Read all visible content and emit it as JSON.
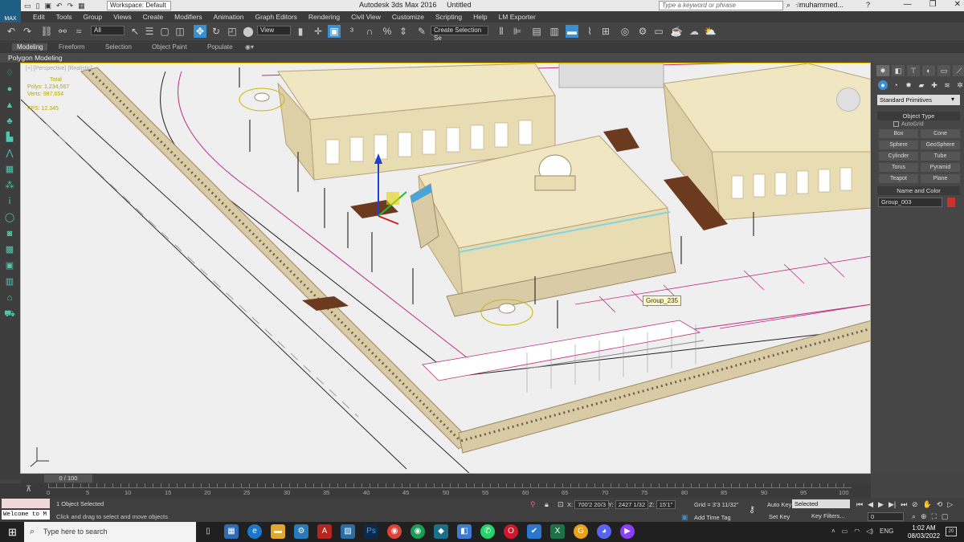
{
  "titlebar": {
    "logo": "MAX",
    "workspace": "Workspace: Default",
    "app_title": "Autodesk 3ds Max 2016",
    "doc_title": "Untitled",
    "search_placeholder": "Type a keyword or phrase",
    "user": "muhammed..."
  },
  "menu": [
    "Edit",
    "Tools",
    "Group",
    "Views",
    "Create",
    "Modifiers",
    "Animation",
    "Graph Editors",
    "Rendering",
    "Civil View",
    "Customize",
    "Scripting",
    "Help",
    "LM Exporter"
  ],
  "toolbar": {
    "filter_value": "All",
    "view_value": "View",
    "selection_set": "Create Selection Se"
  },
  "ribbon": {
    "tabs": [
      "Modeling",
      "Freeform",
      "Selection",
      "Object Paint",
      "Populate"
    ],
    "active": "Modeling",
    "panel_label": "Polygon Modeling"
  },
  "viewport": {
    "label": "[+] [Perspective] [Realistic]",
    "stats": {
      "total": "Total",
      "polys_label": "Polys:",
      "polys": "1,234,567",
      "verts_label": "Verts:",
      "verts": "987,654",
      "fps_label": "FPS:",
      "fps": "12.345"
    },
    "tooltip": "Group_235",
    "colors": {
      "ground": "#efefef",
      "building": "#ece3bf",
      "roof": "#f0e6c2",
      "trim": "#b7a27a",
      "road_line": "#c12b83",
      "boundary": "#e6c300",
      "brick": "#6b3a1f"
    }
  },
  "command_panel": {
    "dropdown": "Standard Primitives",
    "object_type_header": "Object Type",
    "autogrid": "AutoGrid",
    "primitives": [
      "Box",
      "Cone",
      "Sphere",
      "GeoSphere",
      "Cylinder",
      "Tube",
      "Torus",
      "Pyramid",
      "Teapot",
      "Plane"
    ],
    "name_color_header": "Name and Color",
    "object_name": "Group_003",
    "object_color": "#c8322a"
  },
  "timeline": {
    "slider": "0 / 100",
    "ticks": [
      "0",
      "5",
      "10",
      "15",
      "20",
      "25",
      "30",
      "35",
      "40",
      "45",
      "50",
      "55",
      "60",
      "65",
      "70",
      "75",
      "80",
      "85",
      "90",
      "95",
      "100"
    ]
  },
  "status": {
    "listener_text": "Welcome to M",
    "selection": "1 Object Selected",
    "prompt": "Click and drag to select and move objects",
    "x_label": "X:",
    "x": "700'2 20/3",
    "y_label": "Y:",
    "y": "2427 1/32",
    "z_label": "Z:",
    "z": "15'1\"",
    "grid": "Grid = 3'3 11/32\"",
    "add_time_tag": "Add Time Tag",
    "auto_key": "Auto Key",
    "set_key": "Set Key",
    "selected_dropdown": "Selected",
    "key_filters": "Key Filters...",
    "frame": "0"
  },
  "taskbar": {
    "search_placeholder": "Type here to search",
    "lang": "ENG",
    "time": "1:02 AM",
    "date": "08/03/2022",
    "notifications": "20"
  }
}
